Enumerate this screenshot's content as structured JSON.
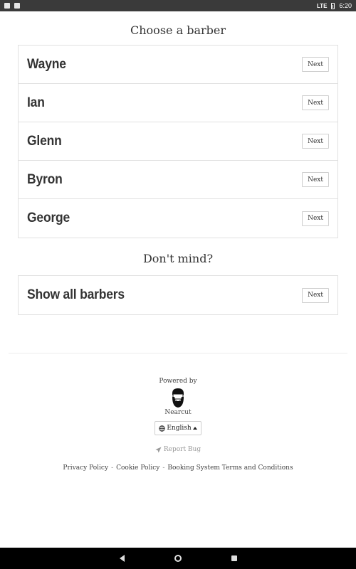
{
  "status_bar": {
    "time": "6:20",
    "signal": "LTE",
    "left_icons": [
      "photo-notification-icon",
      "sim-notification-icon"
    ]
  },
  "section1": {
    "title": "Choose a barber",
    "barbers": [
      {
        "name": "Wayne",
        "button": "Next"
      },
      {
        "name": "Ian",
        "button": "Next"
      },
      {
        "name": "Glenn",
        "button": "Next"
      },
      {
        "name": "Byron",
        "button": "Next"
      },
      {
        "name": "George",
        "button": "Next"
      }
    ]
  },
  "section2": {
    "title": "Don't mind?",
    "option": {
      "name": "Show all barbers",
      "button": "Next"
    }
  },
  "footer": {
    "powered_by": "Powered by",
    "brand": "Nearcut",
    "language": "English",
    "report_bug": "Report Bug",
    "links": [
      "Privacy Policy",
      "Cookie Policy",
      "Booking System Terms and Conditions"
    ],
    "separator": "-"
  },
  "nav_bar": {
    "buttons": [
      "back-icon",
      "home-icon",
      "recents-icon"
    ]
  }
}
